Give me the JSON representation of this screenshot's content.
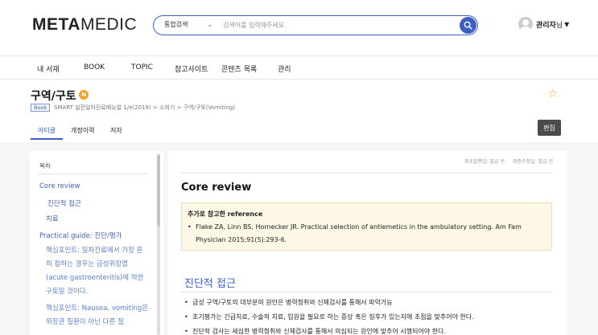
{
  "header": {
    "logo_meta": "META",
    "logo_medic": "MEDIC",
    "search": {
      "scope": "통합검색",
      "placeholder": "검색어를 입력해주세요."
    },
    "user": {
      "name": "관리자",
      "suffix": "님"
    }
  },
  "nav": [
    "내 서재",
    "BOOK",
    "TOPIC",
    "참고사이트",
    "콘텐츠 목록",
    "관리"
  ],
  "doc": {
    "title": "구역/구토",
    "badge": "N",
    "book_tag": "Book",
    "breadcrumb": "SMART 실전일차진료매뉴얼 1/e(2019) > 소화기 > 구역/구토(Vomiting)"
  },
  "tabs": [
    "아티클",
    "개정이력",
    "저자"
  ],
  "edit_label": "편집",
  "toc": {
    "heading": "목차",
    "items": [
      {
        "label": "Core review",
        "level": 1
      },
      {
        "label": "진단적 접근",
        "level": 2
      },
      {
        "label": "치료",
        "level": 2
      },
      {
        "label": "Practical guide: 진단/평가",
        "level": 1
      }
    ],
    "sub_texts": [
      "핵심포인트: 일차진료에서 가장 흔히 접하는 경우는 급성위장염(acute gastroenteritis)에 의한 구토일 것이다.",
      "핵심포인트: Nausea, vomiting은 위장관 질환이 아닌 다른 질"
    ]
  },
  "main": {
    "first_published": "최초발행일: 발급 전",
    "last_modified": "최종수정일: 발급 전",
    "core_heading": "Core review",
    "reference": {
      "title": "추가로 참고한 reference",
      "text": "Flake ZA, Linn BS, Hornecker JR. Practical selection of antiemetics in the ambulatory setting. Am Fam Physician 2015;91(5):293-6."
    },
    "section_heading": "진단적 접근",
    "bullets": [
      "급성 구역/구토의 대부분의 원인은 병력청취와 신체검사를 통해서 파악가능",
      "초기평가는 긴급치료, 수술적 치료, 입원을 필요로 하는 증상 혹은 징후가 있는지에 초점을 맞추어야 한다.",
      "진단적 검사는 세심한 병력청취와 신체검사를 통해서 의심되는 원인에 맞추어 시행되어야 한다."
    ]
  },
  "colors": {
    "accent": "#3e5fbf",
    "badge": "#f0a323",
    "star": "#e8b317",
    "ref_bg": "#fdf8e6"
  }
}
